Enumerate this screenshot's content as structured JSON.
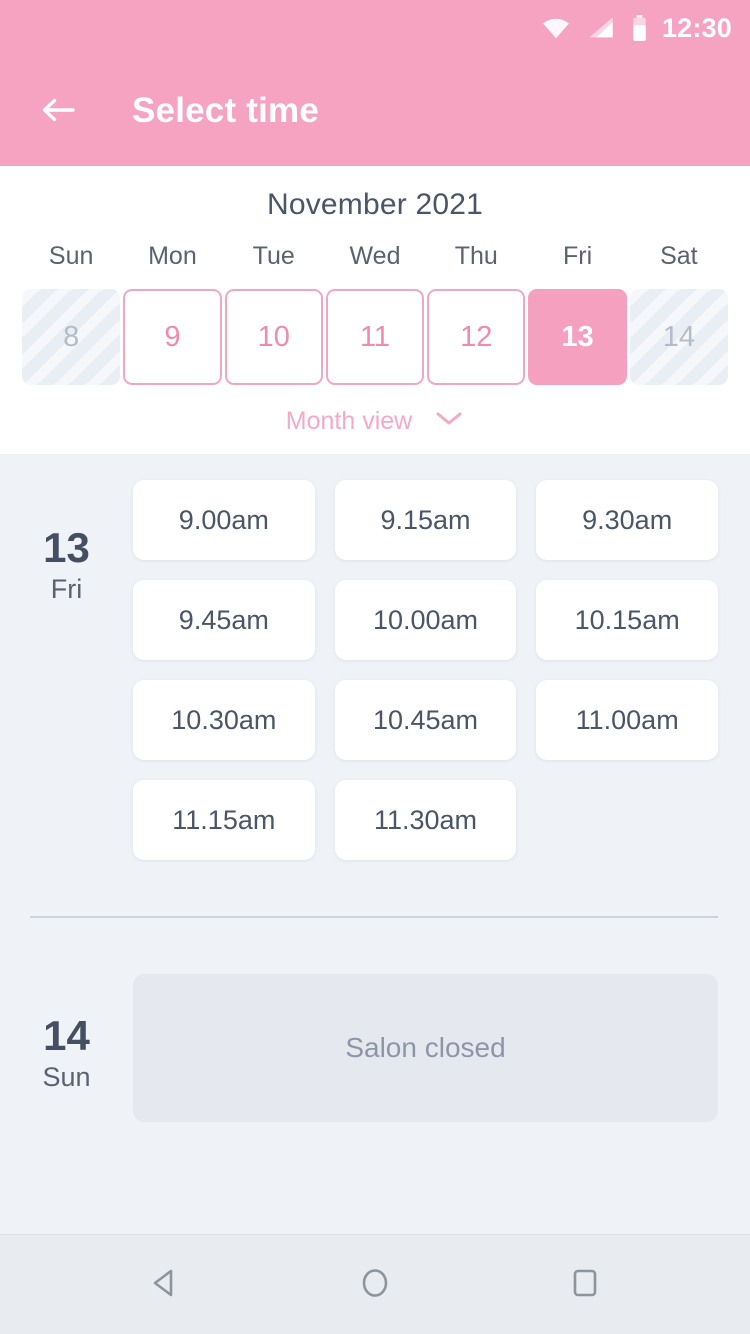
{
  "status_bar": {
    "clock": "12:30",
    "icons": [
      "wifi-icon",
      "signal-icon",
      "battery-icon"
    ]
  },
  "app_bar": {
    "back_icon": "back-arrow-icon",
    "title": "Select time"
  },
  "calendar": {
    "month_title": "November 2021",
    "weekday_headers": [
      "Sun",
      "Mon",
      "Tue",
      "Wed",
      "Thu",
      "Fri",
      "Sat"
    ],
    "days": [
      {
        "num": "8",
        "state": "disabled"
      },
      {
        "num": "9",
        "state": "available"
      },
      {
        "num": "10",
        "state": "available"
      },
      {
        "num": "11",
        "state": "available"
      },
      {
        "num": "12",
        "state": "available"
      },
      {
        "num": "13",
        "state": "selected"
      },
      {
        "num": "14",
        "state": "disabled"
      }
    ],
    "month_view_label": "Month view",
    "month_view_icon": "chevron-down-icon"
  },
  "schedule": {
    "days": [
      {
        "day_num": "13",
        "day_name": "Fri",
        "closed": false,
        "slots": [
          "9.00am",
          "9.15am",
          "9.30am",
          "9.45am",
          "10.00am",
          "10.15am",
          "10.30am",
          "10.45am",
          "11.00am",
          "11.15am",
          "11.30am"
        ]
      },
      {
        "day_num": "14",
        "day_name": "Sun",
        "closed": true,
        "closed_label": "Salon closed",
        "slots": []
      }
    ]
  },
  "nav_bar": {
    "back": "nav-back-icon",
    "home": "nav-home-icon",
    "recents": "nav-recents-icon"
  },
  "colors": {
    "brand_pink": "#f5a3c0",
    "selected_pink": "#f5a0bf",
    "outline_pink": "#f0a8c0",
    "dark_slate": "#4a5568",
    "page_bg": "#eff2f7",
    "closed_bg": "#e5e9ef"
  }
}
